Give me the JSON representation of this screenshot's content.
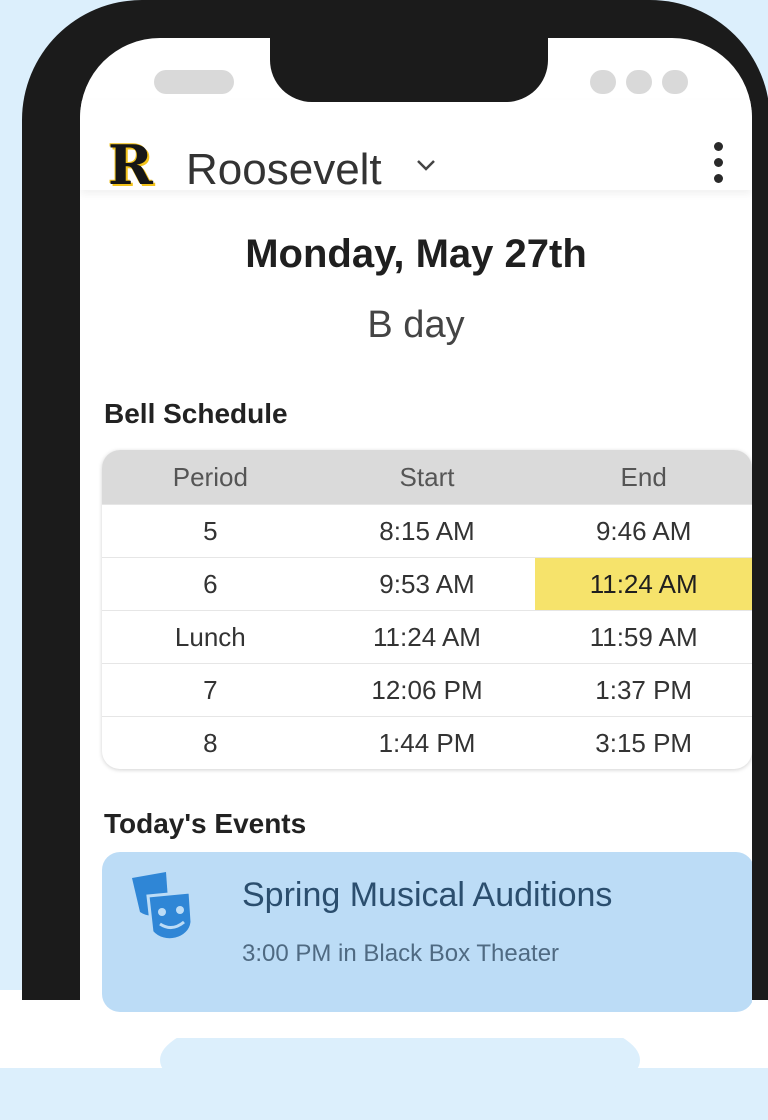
{
  "header": {
    "logo_letter": "R",
    "school_name": "Roosevelt"
  },
  "day": {
    "date": "Monday, May 27th",
    "type": "B day"
  },
  "bell_schedule": {
    "title": "Bell Schedule",
    "columns": [
      "Period",
      "Start",
      "End"
    ],
    "rows": [
      [
        "5",
        "8:15 AM",
        "9:46 AM"
      ],
      [
        "6",
        "9:53 AM",
        "11:24 AM"
      ],
      [
        "Lunch",
        "11:24 AM",
        "11:59 AM"
      ],
      [
        "7",
        "12:06 PM",
        "1:37 PM"
      ],
      [
        "8",
        "1:44 PM",
        "3:15 PM"
      ]
    ],
    "highlight_color": "#f6e36b"
  },
  "events": {
    "title": "Today's Events",
    "items": [
      {
        "title": "Spring Musical Auditions",
        "detail": "3:00 PM in Black Box Theater",
        "icon": "theater-masks-icon"
      }
    ],
    "card_color": "#bcdcf6"
  },
  "colors": {
    "background": "#dceffc",
    "phone_frame": "#1b1b1b",
    "logo_accent": "#f2c21a"
  }
}
